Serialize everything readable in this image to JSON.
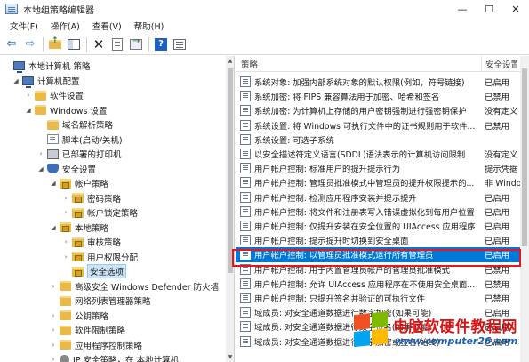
{
  "window": {
    "title": "本地组策略编辑器",
    "minimize": "—",
    "maximize": "☐",
    "close": "✕"
  },
  "menu": [
    "文件(F)",
    "操作(A)",
    "查看(V)",
    "帮助(H)"
  ],
  "toolbar": {
    "buttons": [
      "back-icon",
      "forward-icon",
      "up-folder-icon",
      "show-pane-icon",
      "delete-icon",
      "properties-icon",
      "export-icon",
      "help-icon",
      "list-view-icon"
    ],
    "help_glyph": "?"
  },
  "tree": {
    "items": [
      {
        "label": "本地计算机 策略",
        "icon": "computer-policy-icon",
        "twisty": ""
      },
      {
        "label": "计算机配置",
        "icon": "computer-icon",
        "twisty": "◢"
      },
      {
        "label": "软件设置",
        "icon": "folder-icon",
        "twisty": "›"
      },
      {
        "label": "Windows 设置",
        "icon": "folder-icon",
        "twisty": "◢"
      },
      {
        "label": "域名解析策略",
        "icon": "folder-icon",
        "twisty": ""
      },
      {
        "label": "脚本(启动/关机)",
        "icon": "script-icon",
        "twisty": ""
      },
      {
        "label": "已部署的打印机",
        "icon": "printer-icon",
        "twisty": "›"
      },
      {
        "label": "安全设置",
        "icon": "security-icon",
        "twisty": "◢"
      },
      {
        "label": "帐户策略",
        "icon": "folder-lock-icon",
        "twisty": "◢"
      },
      {
        "label": "密码策略",
        "icon": "folder-lock-icon",
        "twisty": "›"
      },
      {
        "label": "帐户锁定策略",
        "icon": "folder-lock-icon",
        "twisty": "›"
      },
      {
        "label": "本地策略",
        "icon": "folder-lock-icon",
        "twisty": "◢"
      },
      {
        "label": "审核策略",
        "icon": "folder-lock-icon",
        "twisty": "›"
      },
      {
        "label": "用户权限分配",
        "icon": "folder-lock-icon",
        "twisty": "›"
      },
      {
        "label": "安全选项",
        "icon": "folder-lock-icon",
        "twisty": "",
        "selected": true
      },
      {
        "label": "高级安全 Windows Defender 防火墙",
        "icon": "folder-icon",
        "twisty": "›"
      },
      {
        "label": "网络列表管理器策略",
        "icon": "folder-icon",
        "twisty": ""
      },
      {
        "label": "公钥策略",
        "icon": "folder-icon",
        "twisty": "›"
      },
      {
        "label": "软件限制策略",
        "icon": "folder-icon",
        "twisty": "›"
      },
      {
        "label": "应用程序控制策略",
        "icon": "folder-icon",
        "twisty": "›"
      },
      {
        "label": "IP 安全策略，在 本地计算机",
        "icon": "ipsec-icon",
        "twisty": "›"
      }
    ]
  },
  "list": {
    "col_policy": "策略",
    "col_setting": "安全设置",
    "rows": [
      {
        "name": "系统对象: 加强内部系统对象的默认权限(例如，符号链接)",
        "setting": "已启用"
      },
      {
        "name": "系统加密: 将 FIPS 兼容算法用于加密、哈希和签名",
        "setting": "已禁用"
      },
      {
        "name": "系统加密: 为计算机上存储的用户密钥强制进行强密钥保护",
        "setting": "没有定义"
      },
      {
        "name": "系统设置: 将 Windows 可执行文件中的证书规则用于软件...",
        "setting": "已禁用"
      },
      {
        "name": "系统设置: 可选子系统",
        "setting": ""
      },
      {
        "name": "以安全描述符定义语言(SDDL)语法表示的计算机访问限制",
        "setting": "没有定义"
      },
      {
        "name": "用户帐户控制: 标准用户的提升提示行为",
        "setting": "提示凭据"
      },
      {
        "name": "用户帐户控制: 管理员批准模式中管理员的提升权限提示的...",
        "setting": "非 Windows"
      },
      {
        "name": "用户帐户控制: 检测应用程序安装并提示提升",
        "setting": "已启用"
      },
      {
        "name": "用户帐户控制: 将文件和注册表写入错误虚拟化到每用户位置",
        "setting": "已启用"
      },
      {
        "name": "用户帐户控制: 仅提升安装在安全位置的 UIAccess 应用程序",
        "setting": "已启用"
      },
      {
        "name": "用户帐户控制: 提示提升时切换到安全桌面",
        "setting": "已启用"
      },
      {
        "name": "用户帐户控制: 以管理员批准模式运行所有管理员",
        "setting": "已启用",
        "selected": true
      },
      {
        "name": "用户帐户控制: 用于内置管理员帐户的管理员批准模式",
        "setting": "已禁用"
      },
      {
        "name": "用户帐户控制: 允许 UIAccess 应用程序在不使用安全桌面...",
        "setting": "已禁用"
      },
      {
        "name": "用户帐户控制: 只提升签名并验证的可执行文件",
        "setting": "已禁用"
      },
      {
        "name": "域成员: 对安全通道数据进行数字加密(如果可能)",
        "setting": "已启用"
      },
      {
        "name": "域成员: 对安全通道数据进行数字签名(如果可能)",
        "setting": "已启用"
      },
      {
        "name": "域成员: 对安全通道数据进行数字加密或签名(始终)",
        "setting": "已启用"
      }
    ]
  },
  "watermark": {
    "title": "电脑软硬件教程网",
    "url": "www.computer26.com"
  }
}
